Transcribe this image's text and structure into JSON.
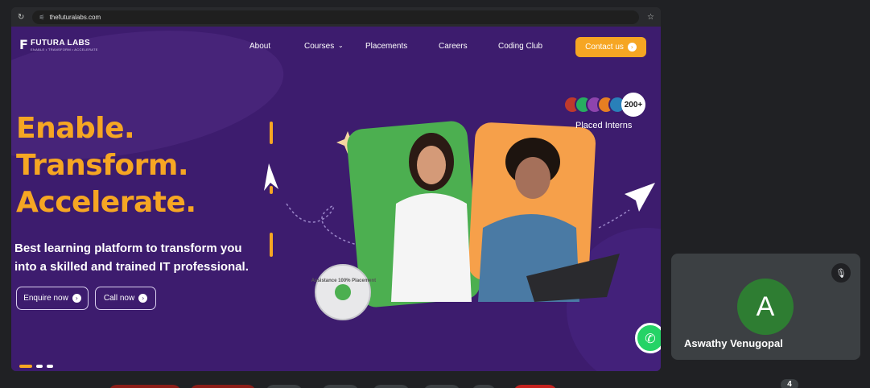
{
  "browser": {
    "url": "thefuturalabs.com",
    "reload_icon": "reload-icon",
    "tune_icon": "site-settings-icon",
    "bookmark_icon": "star-icon"
  },
  "site": {
    "logo": {
      "name": "FUTURA LABS",
      "tagline": "ENABLE • TRANSFORM • ACCELERATE"
    },
    "nav": [
      {
        "label": "About"
      },
      {
        "label": "Courses"
      },
      {
        "label": "Placements"
      },
      {
        "label": "Careers"
      },
      {
        "label": "Coding Club"
      }
    ],
    "contact_label": "Contact us",
    "hero": {
      "line1": "Enable.",
      "line2": "Transform.",
      "line3": "Accelerate.",
      "sub1": "Best learning platform to transform you",
      "sub2": "into a skilled and trained IT professional.",
      "enquire_label": "Enquire now",
      "call_label": "Call now"
    },
    "interns": {
      "count": "200+",
      "label": "Placed Interns"
    },
    "badge": {
      "text": "Assistance 100% Placement"
    },
    "accent_color": "#f6a623",
    "brand_color": "#3d1c6e",
    "slider": {
      "active_index": 0,
      "total": 3
    }
  },
  "participant": {
    "initial": "A",
    "name": "Aswathy Venugopal",
    "mic_icon": "mic-off-icon",
    "avatar_color": "#2e7d32"
  },
  "people_count": "4"
}
